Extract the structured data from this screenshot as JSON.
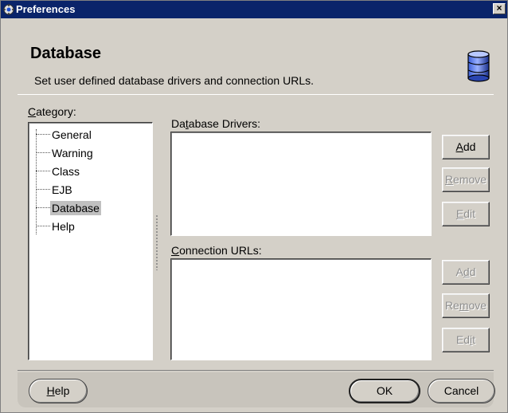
{
  "window": {
    "title": "Preferences",
    "close_label": "×"
  },
  "header": {
    "title": "Database",
    "description": "Set user defined database drivers and connection URLs.",
    "icon": "database-icon"
  },
  "category": {
    "label": "Category:",
    "items": [
      {
        "label": "General",
        "selected": false
      },
      {
        "label": "Warning",
        "selected": false
      },
      {
        "label": "Class",
        "selected": false
      },
      {
        "label": "EJB",
        "selected": false
      },
      {
        "label": "Database",
        "selected": true
      },
      {
        "label": "Help",
        "selected": false
      }
    ]
  },
  "drivers": {
    "label": "Database Drivers:",
    "add_label": "Add",
    "remove_label": "Remove",
    "edit_label": "Edit",
    "items": []
  },
  "urls": {
    "label": "Connection URLs:",
    "add_label": "Add",
    "remove_label": "Remove",
    "edit_label": "Edit",
    "items": []
  },
  "footer": {
    "help_label": "Help",
    "ok_label": "OK",
    "cancel_label": "Cancel"
  }
}
